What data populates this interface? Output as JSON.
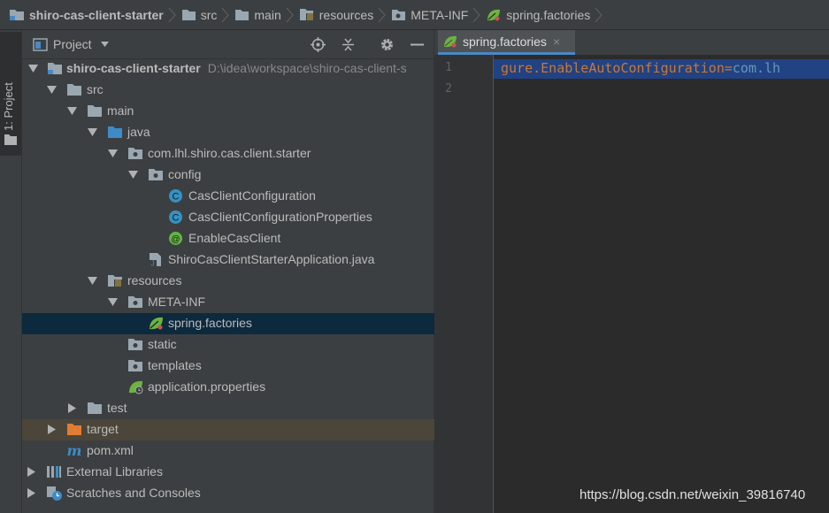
{
  "breadcrumb": [
    {
      "label": "shiro-cas-client-starter",
      "icon": "module-folder-icon"
    },
    {
      "label": "src",
      "icon": "folder-icon"
    },
    {
      "label": "main",
      "icon": "folder-icon"
    },
    {
      "label": "resources",
      "icon": "resources-folder-icon"
    },
    {
      "label": "META-INF",
      "icon": "package-folder-icon"
    },
    {
      "label": "spring.factories",
      "icon": "spring-leaf-icon"
    }
  ],
  "stripe": {
    "label": "1: Project"
  },
  "panel": {
    "title": "Project"
  },
  "tree": [
    {
      "label": "shiro-cas-client-starter",
      "path": "D:\\idea\\workspace\\shiro-cas-client-s",
      "icon": "module-folder-icon",
      "expanded": true
    },
    {
      "label": "src",
      "icon": "folder-icon",
      "expanded": true
    },
    {
      "label": "main",
      "icon": "folder-icon",
      "expanded": true
    },
    {
      "label": "java",
      "icon": "source-folder-icon",
      "expanded": true
    },
    {
      "label": "com.lhl.shiro.cas.client.starter",
      "icon": "package-icon",
      "expanded": true
    },
    {
      "label": "config",
      "icon": "package-icon",
      "expanded": true
    },
    {
      "label": "CasClientConfiguration",
      "icon": "class-icon"
    },
    {
      "label": "CasClientConfigurationProperties",
      "icon": "class-icon"
    },
    {
      "label": "EnableCasClient",
      "icon": "annotation-icon"
    },
    {
      "label": "ShiroCasClientStarterApplication.java",
      "icon": "java-file-icon"
    },
    {
      "label": "resources",
      "icon": "resources-folder-icon",
      "expanded": true
    },
    {
      "label": "META-INF",
      "icon": "package-icon",
      "expanded": true
    },
    {
      "label": "spring.factories",
      "icon": "spring-leaf-icon",
      "selected": true
    },
    {
      "label": "static",
      "icon": "package-icon"
    },
    {
      "label": "templates",
      "icon": "package-icon"
    },
    {
      "label": "application.properties",
      "icon": "spring-properties-icon"
    },
    {
      "label": "test",
      "icon": "folder-icon",
      "expanded": false
    },
    {
      "label": "target",
      "icon": "excluded-folder-icon",
      "expanded": false
    },
    {
      "label": "pom.xml",
      "icon": "maven-icon"
    },
    {
      "label": "External Libraries",
      "icon": "libraries-icon",
      "expanded": false
    },
    {
      "label": "Scratches and Consoles",
      "icon": "scratches-icon",
      "expanded": false
    }
  ],
  "editor": {
    "tab": {
      "label": "spring.factories",
      "close": "×"
    },
    "line_numbers": [
      "1",
      "2"
    ],
    "code": {
      "key": "gure.EnableAutoConfiguration",
      "eq": "=",
      "val": "com.lh"
    }
  },
  "watermark": "https://blog.csdn.net/weixin_39816740",
  "colors": {
    "background": "#2b2b2b",
    "panel": "#3c3f41",
    "selection": "#0d293e",
    "excluded": "#4b4639",
    "code_selection": "#214283",
    "spring_green": "#6db33f"
  }
}
